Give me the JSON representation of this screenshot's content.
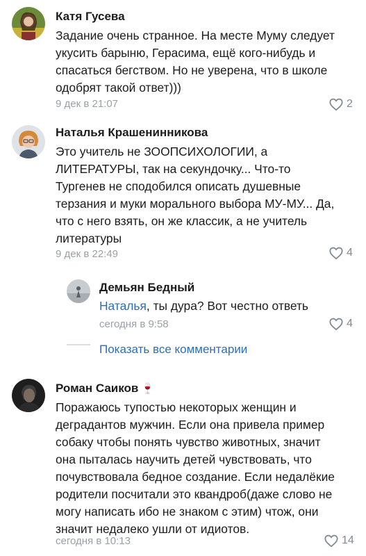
{
  "comments": [
    {
      "author": "Катя Гусева",
      "lines": [
        "Задание очень странное. На месте Муму следует",
        "укусить барыню, Герасима, ещё кого-нибудь и",
        "спасаться бегством. Но не уверена, что в школе",
        "одобрят такой ответ)))"
      ],
      "time": "9 дек в 21:07",
      "likes": "2"
    },
    {
      "author": "Наталья Крашенинникова",
      "lines": [
        "Это учитель не ЗООПСИХОЛОГИИ, а",
        "ЛИТЕРАТУРЫ, так на секундочку... Что-то",
        "Тургенев не сподобился описать душевные",
        "терзания и муки морального выбора МУ-МУ... Да,",
        "что с него взять, он же классик, а не учитель",
        "литературы"
      ],
      "time": "9 дек в 22:49",
      "likes": "4"
    },
    {
      "author": "Демьян Бедный",
      "reply_to": "Наталья",
      "text_after": ", ты дура? Вот честно ответь",
      "time": "сегодня в 9:58",
      "likes": "4"
    },
    {
      "author": "Роман Саиков",
      "author_badge": "🍷",
      "lines": [
        "Поражаюсь тупостью некоторых женщин и",
        "деградантов мужчин. Если она привела пример",
        "собаку чтобы понять чувство животных, значит",
        "она пыталась научить детей чувствовать, что",
        "почувствовала бедное создание. Если недалёкие",
        "родители посчитали это квандроб(даже слово не",
        "могу написать ибо не знаком с этим) чтож, они",
        "значит недалеко ушли от идиотов."
      ],
      "time": "сегодня в 10:13",
      "likes": "14"
    }
  ],
  "show_all_label": "Показать все комментарии",
  "icons": {
    "like": "heart-outline-icon"
  },
  "colors": {
    "link": "#2a6fb8",
    "meta": "#9ba0a6",
    "text": "#1c1c1c"
  }
}
